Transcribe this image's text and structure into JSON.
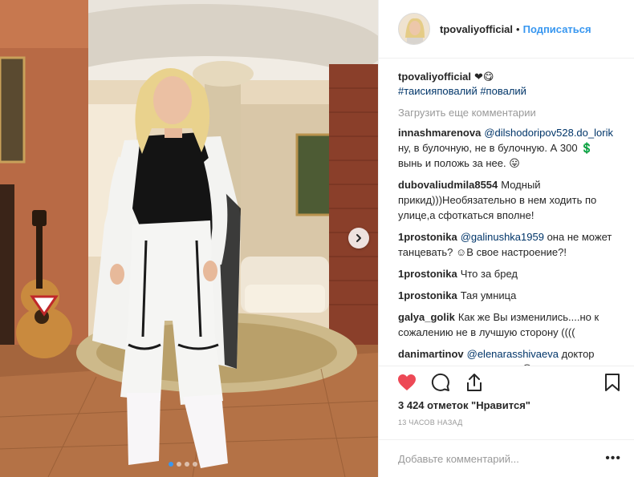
{
  "post": {
    "username": "tpovaliyofficial",
    "separator": "•",
    "follow_label": "Подписаться",
    "caption_text": "❤😋",
    "caption_tags": [
      "#таисияповалий",
      "#повалий"
    ],
    "load_more_label": "Загрузить еще комментарии",
    "image_indicator": {
      "count": 4,
      "active": 0
    }
  },
  "comments": [
    {
      "user": "innashmarenova",
      "mention": "@dilshodoripov528.do_lorik",
      "text": " ну, в булочную, не в булочную. А 300 💲 вынь и положь за нее. 😛"
    },
    {
      "user": "dubovaliudmila8554",
      "mention": "",
      "text": "Модный прикид)))Необязательно в нем ходить по улице,а сфоткаться вполне!"
    },
    {
      "user": "1prostonika",
      "mention": "@galinushka1959",
      "text": " она не может танцевать? ☺В свое настроение?!"
    },
    {
      "user": "1prostonika",
      "mention": "",
      "text": "Что за бред"
    },
    {
      "user": "1prostonika",
      "mention": "",
      "text": "Тая умница"
    },
    {
      "user": "galya_golik",
      "mention": "",
      "text": "Как же Вы изменились....но к сожалению не в лучшую сторону (((("
    },
    {
      "user": "danimartinov",
      "mention": "@elenarasshivaeva",
      "text": " доктор Расшиваева вы жестокая😳"
    }
  ],
  "footer": {
    "likes_text": "3 424 отметок \"Нравится\"",
    "time_text": "13 ЧАСОВ НАЗАД",
    "comment_placeholder": "Добавьте комментарий...",
    "more_label": "•••"
  },
  "icons": {
    "like": "heart-filled-icon",
    "comment": "comment-bubble-icon",
    "share": "share-icon",
    "save": "bookmark-icon",
    "next": "chevron-right-icon"
  },
  "colors": {
    "link": "#3897f0",
    "like": "#ed4956",
    "muted": "#999999",
    "mention": "#003569"
  }
}
